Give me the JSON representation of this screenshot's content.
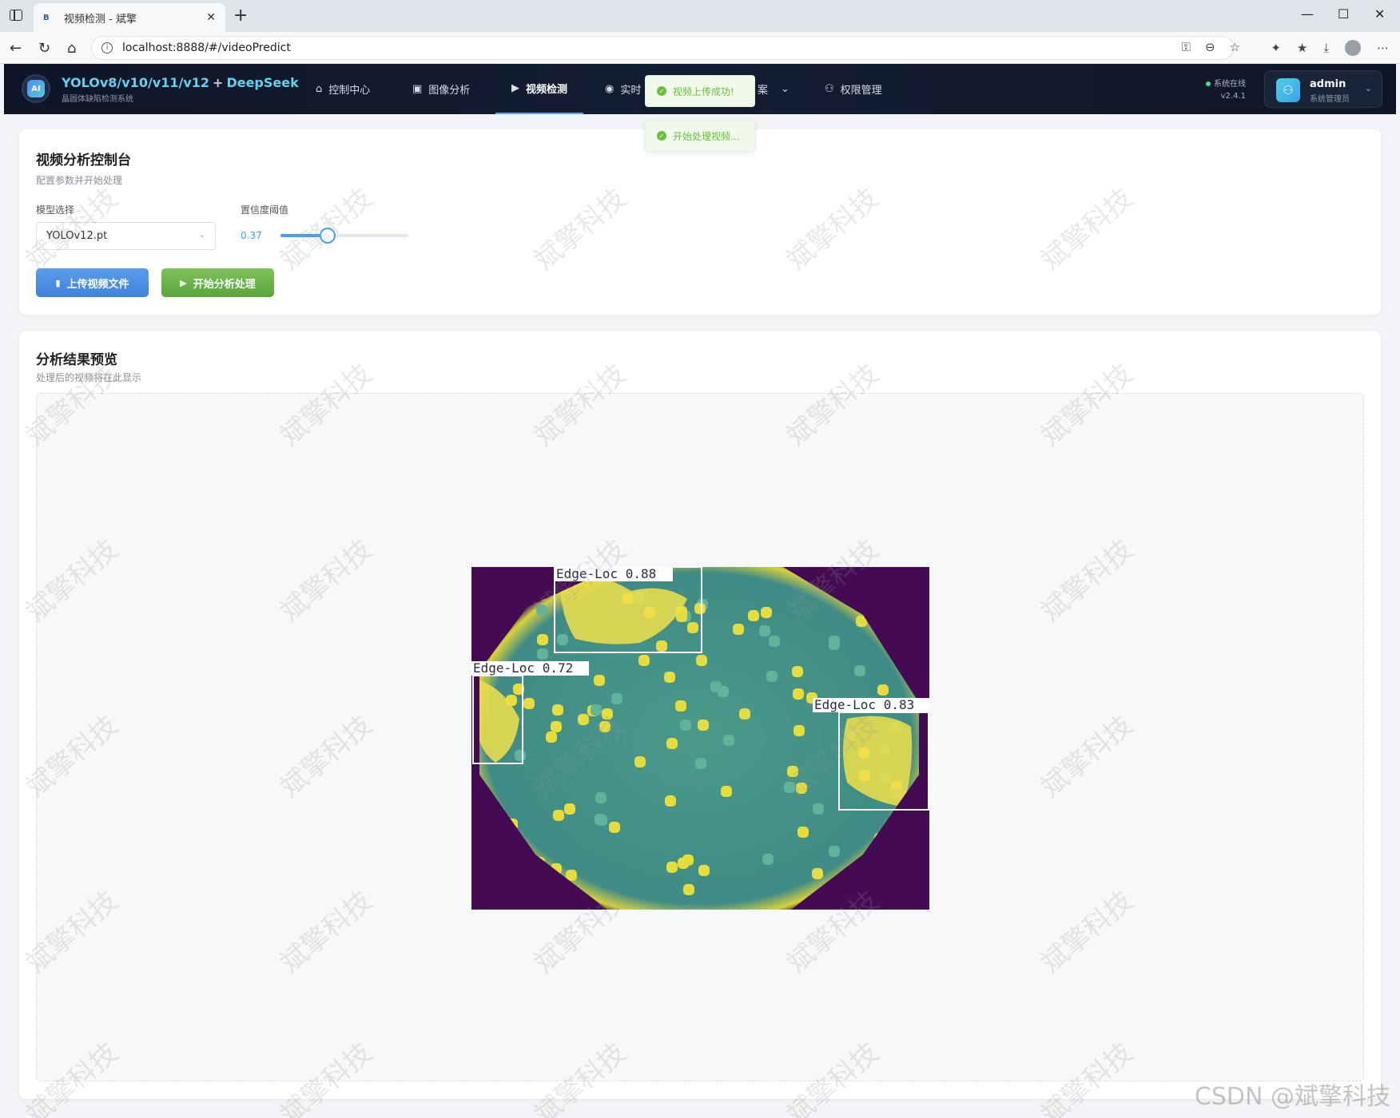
{
  "browser": {
    "tab_title": "视频检测 - 斌擎",
    "tab_favicon": "B",
    "url": "localhost:8888/#/videoPredict"
  },
  "header": {
    "brand_models": "YOLOv8/v10/v11/v12",
    "brand_plus": "+",
    "brand_llm": "DeepSeek",
    "brand_subtitle": "晶圆体缺陷检测系统",
    "logo_text": "AI",
    "nav": [
      {
        "label": "控制中心",
        "icon": "home-icon"
      },
      {
        "label": "图像分析",
        "icon": "image-icon"
      },
      {
        "label": "视频检测",
        "icon": "play-circle-icon",
        "active": true
      },
      {
        "label": "实时",
        "icon": "camera-icon"
      },
      {
        "label": "案",
        "icon": "chevron-down-icon"
      },
      {
        "label": "权限管理",
        "icon": "user-icon"
      }
    ],
    "status_text": "系统在线",
    "version": "v2.4.1",
    "user": {
      "name": "admin",
      "role": "系统管理员"
    }
  },
  "toasts": [
    "视频上传成功!",
    "开始处理视频..."
  ],
  "control": {
    "title": "视频分析控制台",
    "subtitle": "配置参数并开始处理",
    "model_label": "模型选择",
    "model_value": "YOLOv12.pt",
    "conf_label": "置信度阈值",
    "conf_value": "0.37",
    "conf_fraction": 0.37,
    "upload_label": "上传视频文件",
    "start_label": "开始分析处理"
  },
  "result": {
    "title": "分析结果预览",
    "subtitle": "处理后的视频将在此显示",
    "detections": [
      {
        "label": "Edge-Loc 0.88"
      },
      {
        "label": "Edge-Loc 0.72"
      },
      {
        "label": "Edge-Loc 0.83"
      }
    ]
  },
  "watermark": {
    "text": "斌擎科技",
    "footer": "CSDN @斌擎科技"
  }
}
